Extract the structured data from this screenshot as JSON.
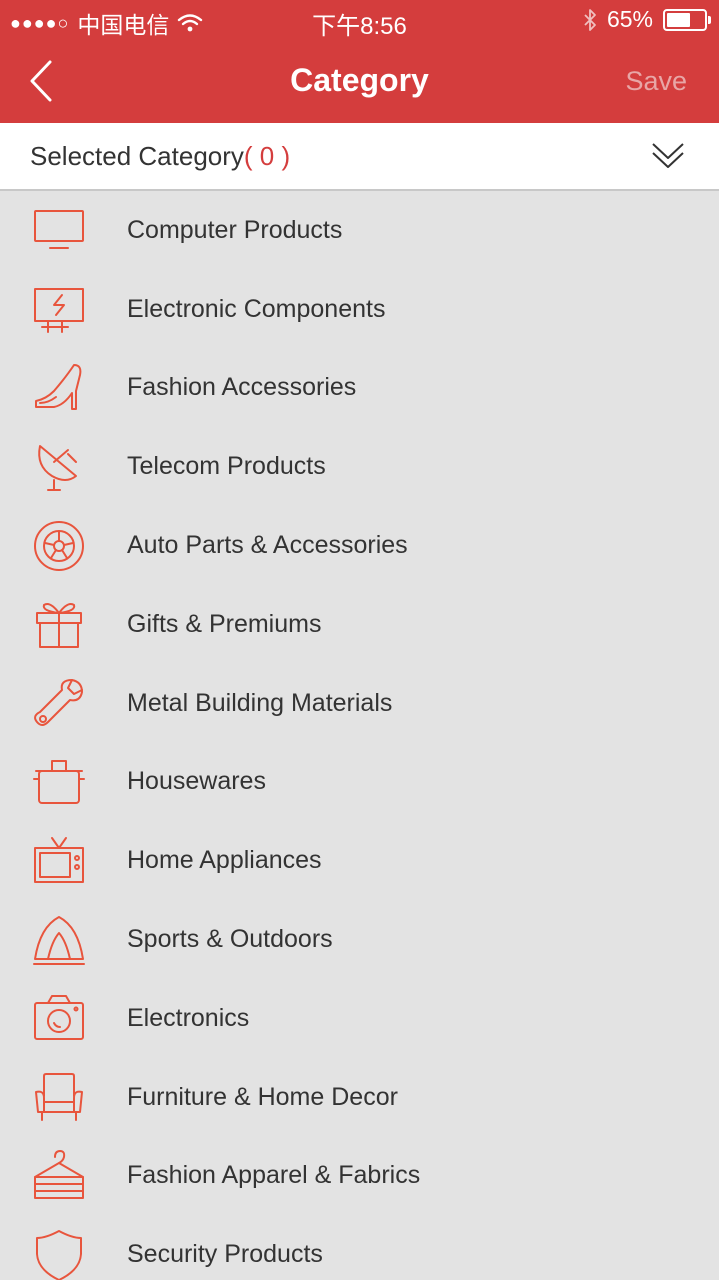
{
  "status_bar": {
    "signal": "●●●●○",
    "carrier": "中国电信",
    "time": "下午8:56",
    "battery_text": "65%",
    "battery_level": 0.65
  },
  "nav": {
    "title": "Category",
    "save_label": "Save"
  },
  "selected": {
    "label": "Selected Category",
    "count": "( 0 )"
  },
  "categories": [
    {
      "label": "Computer Products",
      "icon": "monitor-icon"
    },
    {
      "label": "Electronic Components",
      "icon": "circuit-board-icon"
    },
    {
      "label": "Fashion Accessories",
      "icon": "high-heel-icon"
    },
    {
      "label": "Telecom Products",
      "icon": "satellite-dish-icon"
    },
    {
      "label": "Auto Parts & Accessories",
      "icon": "wheel-icon"
    },
    {
      "label": "Gifts & Premiums",
      "icon": "gift-icon"
    },
    {
      "label": "Metal Building Materials",
      "icon": "wrench-icon"
    },
    {
      "label": "Housewares",
      "icon": "pot-icon"
    },
    {
      "label": "Home Appliances",
      "icon": "tv-icon"
    },
    {
      "label": "Sports & Outdoors",
      "icon": "tent-icon"
    },
    {
      "label": "Electronics",
      "icon": "camera-icon"
    },
    {
      "label": "Furniture & Home Decor",
      "icon": "armchair-icon"
    },
    {
      "label": "Fashion Apparel & Fabrics",
      "icon": "clothes-hanger-icon"
    },
    {
      "label": "Security Products",
      "icon": "shield-icon"
    }
  ],
  "colors": {
    "brand_red": "#d43d3d",
    "icon_orange": "#e8553d",
    "list_bg": "#e3e3e3"
  }
}
